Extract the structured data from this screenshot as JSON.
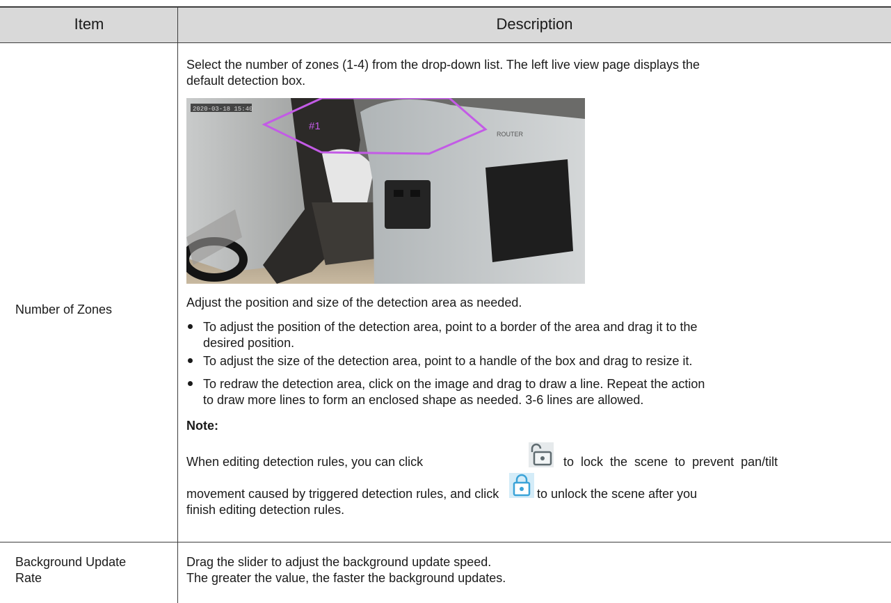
{
  "table": {
    "headers": {
      "item": "Item",
      "description": "Description"
    },
    "rows": [
      {
        "item": "Number of Zones",
        "intro": "Select the number of zones (1-4) from the drop-down list. The left live view page displays the default detection box.",
        "intro_l1": "Select the number of zones (1-4) from the drop-down list. The left live view page displays the",
        "intro_l2": "default detection box.",
        "image": {
          "timestamp": "2020-03-18 15:40",
          "zone_label": "#1",
          "device_label": "ROUTER"
        },
        "adjust": "Adjust the position and size of the detection area as needed.",
        "bullets": [
          {
            "l1": "To adjust the position of the detection area, point to a border of the area and drag it to the",
            "l2": "desired position."
          },
          {
            "l1": "To adjust the size of the detection area, point to a handle of the box and drag to resize it.",
            "l2": ""
          },
          {
            "l1": "To redraw the detection area, click on the image and drag to draw a line. Repeat the action",
            "l2": "to draw more lines to form an enclosed shape as needed. 3-6 lines are allowed."
          }
        ],
        "note_title": "Note:",
        "note_a": "When editing detection rules, you can click",
        "note_b": "to lock the scene to prevent pan/tilt",
        "note_c": "movement caused by triggered detection rules, and click",
        "note_d": "to unlock the scene after you",
        "note_e": "finish editing detection rules.",
        "icons": {
          "lock": "unlocked-padlock-icon",
          "unlock": "locked-padlock-icon",
          "color": "#3aa3d8"
        }
      },
      {
        "item_l1": "Background Update",
        "item_l2": "Rate",
        "d1": "Drag the slider to adjust the background update speed.",
        "d2": "The greater the value, the faster the background updates."
      }
    ]
  }
}
